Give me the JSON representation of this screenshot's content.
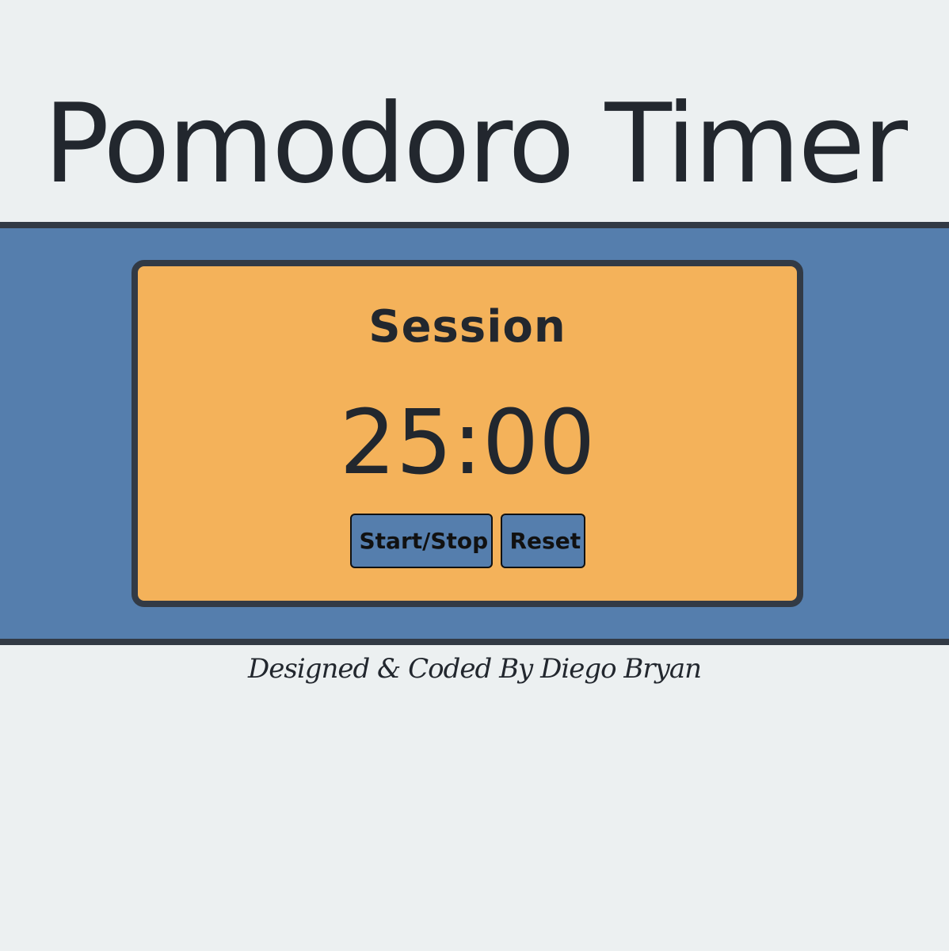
{
  "header": {
    "title": "Pomodoro Timer"
  },
  "timer": {
    "label": "Session",
    "time": "25:00",
    "start_stop_label": "Start/Stop",
    "reset_label": "Reset"
  },
  "footer": {
    "credit": "Designed & Coded By Diego Bryan"
  },
  "colors": {
    "background": "#ecf0f1",
    "band": "#557ead",
    "card": "#f4b25a",
    "border": "#323a45",
    "text": "#22272e"
  }
}
